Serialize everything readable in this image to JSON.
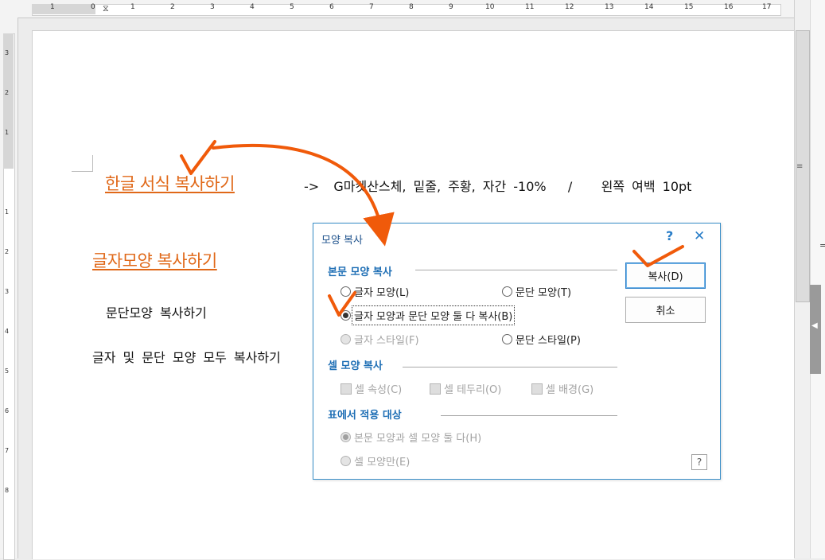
{
  "ruler": {
    "top_numbers": [
      "1",
      "0",
      "1",
      "2",
      "3",
      "4",
      "5",
      "6",
      "7",
      "8",
      "9",
      "10",
      "11",
      "12",
      "13",
      "14",
      "15",
      "16",
      "17"
    ],
    "left_numbers": [
      "3",
      "2",
      "1",
      "1",
      "2",
      "3",
      "4",
      "5",
      "6",
      "7",
      "8"
    ]
  },
  "document": {
    "heading1": "한글 서식 복사하기",
    "note": "->  G마켓산스체, 밑줄, 주황, 자간 -10%   /    왼쪽 여백 10pt",
    "heading2": "글자모양 복사하기",
    "line1": "문단모양 복사하기",
    "line2": "글자 및 문단 모양 모두 복사하기"
  },
  "dialog": {
    "title": "모양 복사",
    "help": "?",
    "close": "✕",
    "section_body": "본문 모양 복사",
    "opt_char": "글자 모양(L)",
    "opt_para": "문단 모양(T)",
    "opt_both": "글자 모양과 문단 모양 둘 다 복사(B)",
    "opt_char_style": "글자 스타일(F)",
    "opt_para_style": "문단 스타일(P)",
    "section_cell": "셀 모양 복사",
    "chk_cell_attr": "셀 속성(C)",
    "chk_cell_border": "셀 테두리(O)",
    "chk_cell_bg": "셀 배경(G)",
    "section_table": "표에서 적용 대상",
    "opt_body_and_cell": "본문 모양과 셀 모양 둘 다(H)",
    "opt_cell_only": "셀 모양만(E)",
    "btn_copy": "복사(D)",
    "btn_cancel": "취소",
    "help_small": "?"
  },
  "side": {
    "edge_char": "="
  },
  "colors": {
    "title_orange": "#e06818",
    "annotation_orange": "#f05a0a",
    "dialog_accent": "#2a7ec8"
  }
}
